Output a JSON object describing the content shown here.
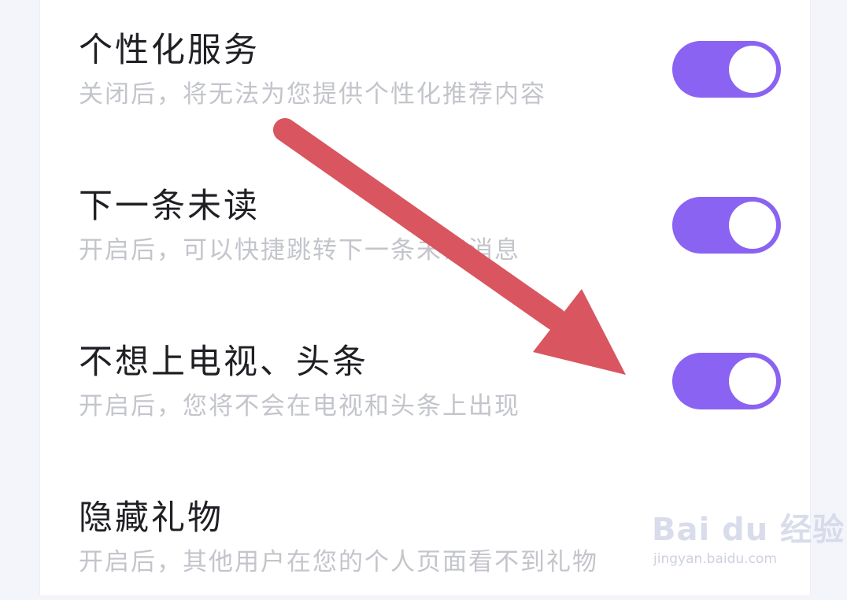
{
  "settings": [
    {
      "title": "个性化服务",
      "desc": "关闭后，将无法为您提供个性化推荐内容",
      "enabled": true
    },
    {
      "title": "下一条未读",
      "desc": "开启后，可以快捷跳转下一条未读消息",
      "enabled": true
    },
    {
      "title": "不想上电视、头条",
      "desc": "开启后，您将不会在电视和头条上出现",
      "enabled": true
    },
    {
      "title": "隐藏礼物",
      "desc": "开启后，其他用户在您的个人页面看不到礼物",
      "enabled": false
    }
  ],
  "watermark": {
    "logo": "Bai du 经验",
    "url": "jingyan.baidu.com"
  },
  "colors": {
    "toggle_on": "#8a63f2",
    "arrow": "#d9555f",
    "title": "#1f1f24",
    "desc": "#c3c5cb"
  }
}
